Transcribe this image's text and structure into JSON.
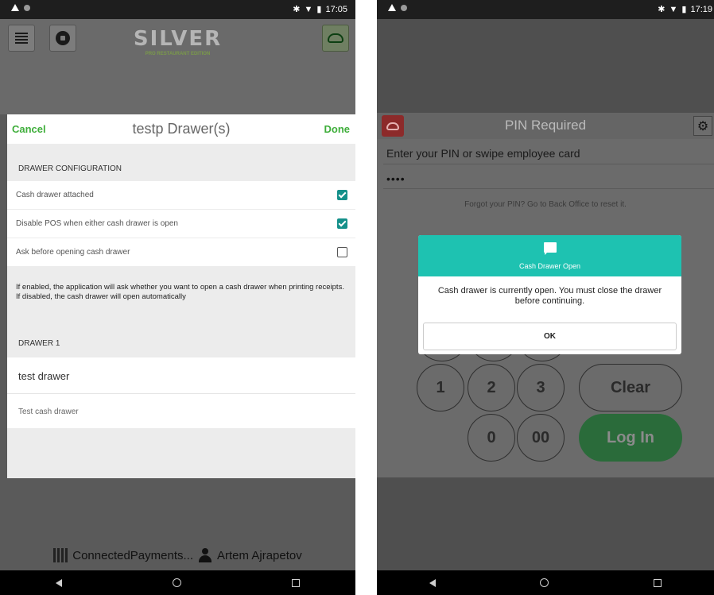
{
  "left": {
    "status": {
      "time": "17:05",
      "icons": [
        "warning-icon",
        "dot-icon",
        "bluetooth-icon",
        "wifi-icon",
        "battery-icon"
      ]
    },
    "app": {
      "logo": "SILVER",
      "logo_sub": "PRO RESTAURANT EDITION"
    },
    "sheet": {
      "cancel_label": "Cancel",
      "title": "testp Drawer(s)",
      "done_label": "Done",
      "config_section": "DRAWER CONFIGURATION",
      "options": [
        {
          "label": "Cash drawer attached",
          "checked": true
        },
        {
          "label": "Disable POS when either cash drawer is open",
          "checked": true
        },
        {
          "label": "Ask before opening cash drawer",
          "checked": false
        }
      ],
      "hint": "If enabled, the application will ask whether you want to open a cash drawer when printing receipts. If disabled, the cash drawer will open automatically",
      "drawer_section": "DRAWER 1",
      "drawer_name": "test drawer",
      "drawer_description": "Test cash drawer"
    },
    "footer": {
      "location": "ConnectedPayments...",
      "user": "Artem Ajrapetov"
    }
  },
  "right": {
    "status": {
      "time": "17:19"
    },
    "pin": {
      "title": "PIN Required",
      "prompt": "Enter your PIN or swipe employee card",
      "value": "••••",
      "forgot": "Forgot your PIN? Go to Back Office to reset it."
    },
    "keys": {
      "k1": "1",
      "k2": "2",
      "k3": "3",
      "k0": "0",
      "k00": "00",
      "clear": "Clear",
      "login": "Log In"
    },
    "dialog": {
      "title": "Cash Drawer Open",
      "message": "Cash drawer is currently open. You must close the drawer before continuing.",
      "ok": "OK"
    }
  },
  "colors": {
    "accent_green": "#3fae3b",
    "teal": "#1ec2b1",
    "checkbox_teal": "#14908a",
    "login_green": "#2a6b3a"
  }
}
